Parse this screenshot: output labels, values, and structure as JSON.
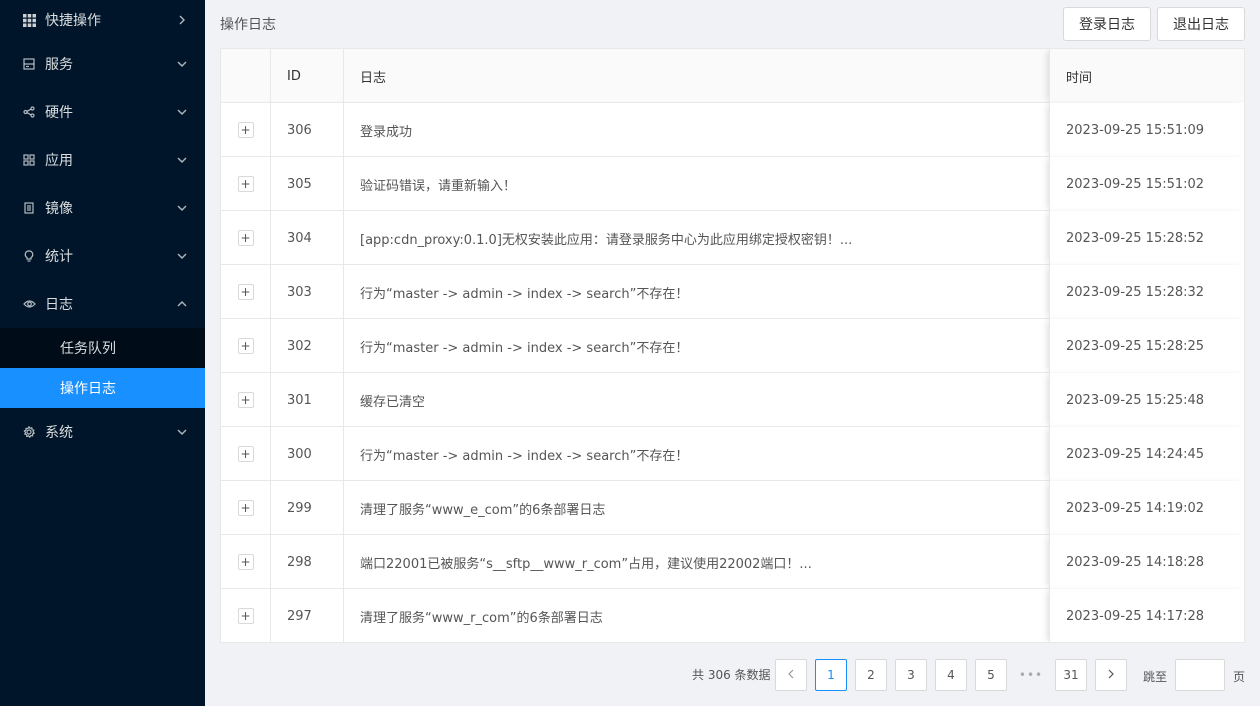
{
  "sidebar": {
    "items": [
      {
        "label": "快捷操作",
        "icon": "grid-icon"
      },
      {
        "label": "服务",
        "icon": "server-icon"
      },
      {
        "label": "硬件",
        "icon": "share-icon"
      },
      {
        "label": "应用",
        "icon": "apps-icon"
      },
      {
        "label": "镜像",
        "icon": "document-icon"
      },
      {
        "label": "统计",
        "icon": "bulb-icon"
      },
      {
        "label": "日志",
        "icon": "eye-icon"
      },
      {
        "label": "系统",
        "icon": "gear-icon"
      }
    ],
    "log_submenu": [
      {
        "label": "任务队列"
      },
      {
        "label": "操作日志",
        "active": true
      }
    ],
    "accent_color": "#1890ff",
    "bg_color": "#001529"
  },
  "header": {
    "title": "操作日志",
    "login_log_button": "登录日志",
    "logout_log_button": "退出日志"
  },
  "table": {
    "columns": {
      "id": "ID",
      "log": "日志",
      "time": "时间"
    },
    "rows": [
      {
        "id": "306",
        "log": "登录成功",
        "time": "2023-09-25 15:51:09"
      },
      {
        "id": "305",
        "log": "验证码错误，请重新输入！",
        "time": "2023-09-25 15:51:02"
      },
      {
        "id": "304",
        "log": "[app:cdn_proxy:0.1.0]无权安装此应用：请登录服务中心为此应用绑定授权密钥！...",
        "time": "2023-09-25 15:28:52"
      },
      {
        "id": "303",
        "log": "行为“master -> admin -> index -> search”不存在！",
        "time": "2023-09-25 15:28:32"
      },
      {
        "id": "302",
        "log": "行为“master -> admin -> index -> search”不存在！",
        "time": "2023-09-25 15:28:25"
      },
      {
        "id": "301",
        "log": "缓存已清空",
        "time": "2023-09-25 15:25:48"
      },
      {
        "id": "300",
        "log": "行为“master -> admin -> index -> search”不存在！",
        "time": "2023-09-25 14:24:45"
      },
      {
        "id": "299",
        "log": "清理了服务“www_e_com”的6条部署日志",
        "time": "2023-09-25 14:19:02"
      },
      {
        "id": "298",
        "log": "端口22001已被服务“s__sftp__www_r_com”占用，建议使用22002端口！...",
        "time": "2023-09-25 14:18:28"
      },
      {
        "id": "297",
        "log": "清理了服务“www_r_com”的6条部署日志",
        "time": "2023-09-25 14:17:28"
      }
    ],
    "expand_symbol": "+"
  },
  "pagination": {
    "total_text": "共 306 条数据",
    "prev": "‹",
    "next": "›",
    "pages": [
      "1",
      "2",
      "3",
      "4",
      "5"
    ],
    "ellipsis": "•••",
    "last_page": "31",
    "current": "1",
    "jump_label": "跳至",
    "jump_suffix": "页"
  }
}
